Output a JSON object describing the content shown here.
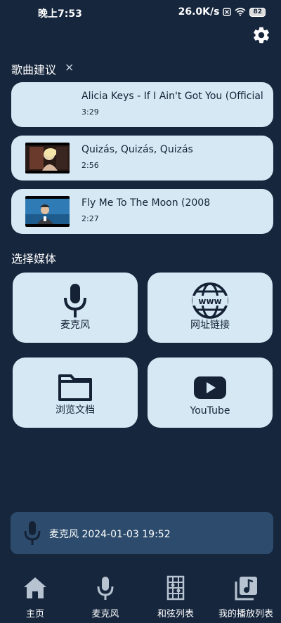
{
  "status_bar": {
    "time": "晚上7:53",
    "network_speed": "26.0K/s",
    "battery": "82"
  },
  "suggestions": {
    "title": "歌曲建议",
    "close_label": "×",
    "songs": [
      {
        "title": "Alicia Keys - If I Ain't Got You (Official",
        "duration": "3:29",
        "thumb": "none"
      },
      {
        "title": "Quizás, Quizás, Quizás",
        "duration": "2:56",
        "thumb": "woman"
      },
      {
        "title": "Fly Me To The Moon (2008",
        "duration": "2:27",
        "thumb": "man"
      }
    ]
  },
  "media": {
    "title": "选择媒体",
    "buttons": [
      {
        "label": "麦克风",
        "icon": "microphone-icon"
      },
      {
        "label": "网址链接",
        "icon": "www-globe-icon"
      },
      {
        "label": "浏览文档",
        "icon": "folder-icon"
      },
      {
        "label": "YouTube",
        "icon": "youtube-icon"
      }
    ]
  },
  "recent": {
    "text": "麦克风 2024-01-03 19:52",
    "icon": "microphone-icon"
  },
  "nav": [
    {
      "label": "主页",
      "icon": "home-icon"
    },
    {
      "label": "麦克风",
      "icon": "microphone-icon"
    },
    {
      "label": "和弦列表",
      "icon": "chord-grid-icon"
    },
    {
      "label": "我的播放列表",
      "icon": "playlist-icon"
    }
  ],
  "colors": {
    "background": "#16263d",
    "card": "#d6e8f4",
    "recent_bar": "#2d4c6d",
    "dark_text": "#152235",
    "icon_gray": "#b7c3d0"
  }
}
